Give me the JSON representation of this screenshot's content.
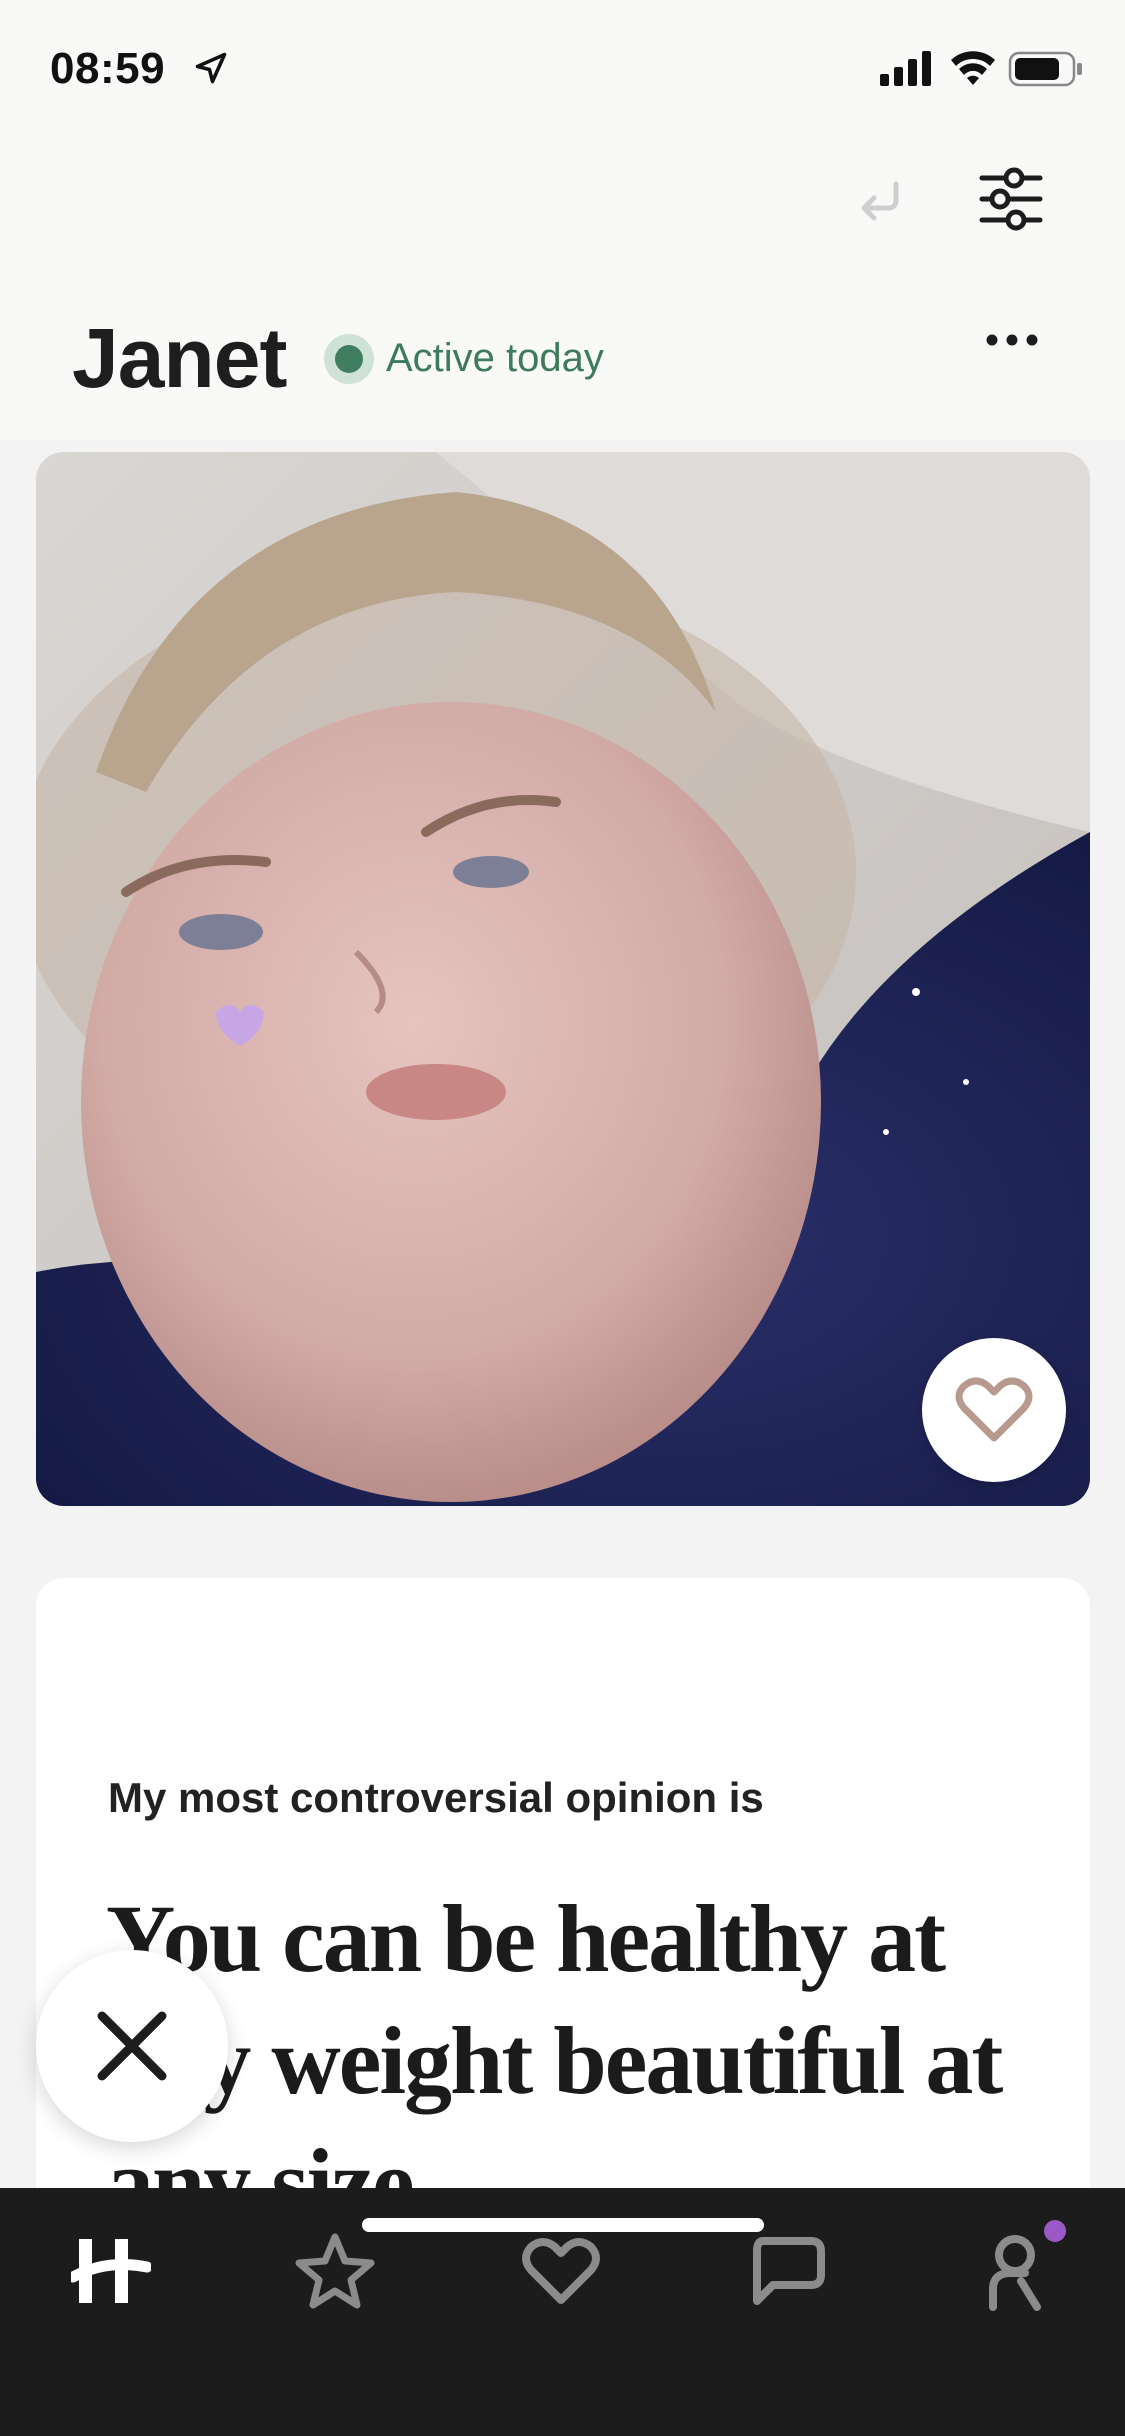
{
  "status_bar": {
    "time": "08:59"
  },
  "profile": {
    "name": "Janet",
    "activity_status": "Active today"
  },
  "prompt": {
    "question": "My most controversial opinion is",
    "answer": "You can be healthy at any weight beautiful at any size"
  },
  "icons": {
    "location": "location-arrow-icon",
    "signal": "cellular-signal-icon",
    "wifi": "wifi-icon",
    "battery": "battery-icon",
    "undo": "undo-icon",
    "filter": "filter-sliders-icon",
    "more": "more-dots-icon",
    "like": "heart-icon",
    "skip": "close-x-icon"
  },
  "tab_bar": {
    "tabs": [
      {
        "name": "home",
        "icon": "hinge-logo-icon",
        "active": true
      },
      {
        "name": "standouts",
        "icon": "star-icon",
        "active": false
      },
      {
        "name": "likes-you",
        "icon": "heart-icon",
        "active": false
      },
      {
        "name": "matches",
        "icon": "chat-bubble-icon",
        "active": false
      },
      {
        "name": "profile",
        "icon": "person-icon",
        "active": false,
        "has_notification": true
      }
    ]
  },
  "colors": {
    "active_green": "#3f7f5f",
    "tab_bar_bg": "#1c1c1c",
    "notification_dot": "#9b59c6",
    "like_heart": "#b8998d"
  }
}
